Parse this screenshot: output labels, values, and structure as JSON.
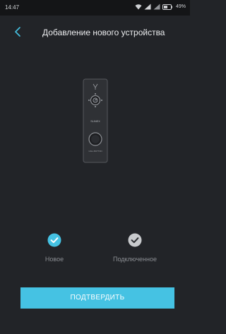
{
  "status_bar": {
    "time": "14:47",
    "battery": "49%"
  },
  "header": {
    "title": "Добавление нового устройства",
    "back_icon": "chevron-left-icon"
  },
  "device": {
    "brand": "SLINEX",
    "caption": "CALL BUTTON"
  },
  "options": [
    {
      "label": "Новое",
      "selected": true,
      "check_color": "#45c2e3"
    },
    {
      "label": "Подключенное",
      "selected": false,
      "check_color": "#c8cacd"
    }
  ],
  "confirm_button": {
    "label": "ПОДТВЕРДИТЬ",
    "color": "#45c2e3"
  },
  "colors": {
    "background": "#222428",
    "accent": "#45c2e3"
  }
}
